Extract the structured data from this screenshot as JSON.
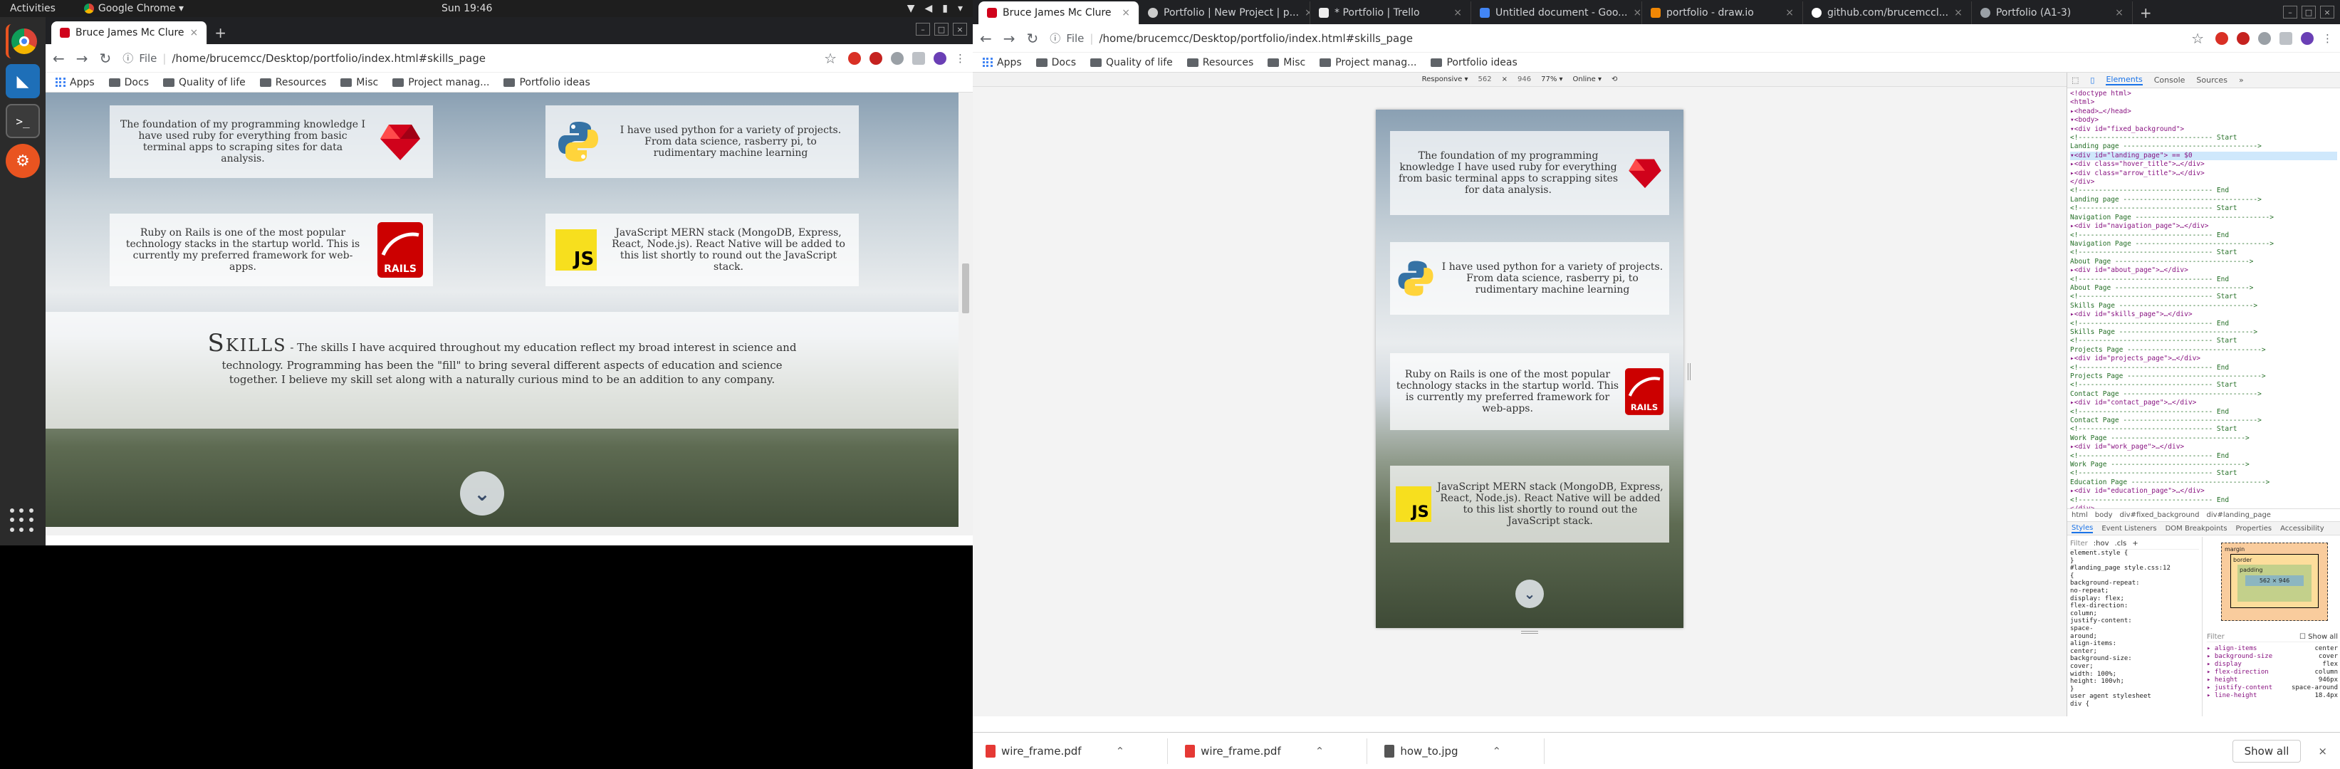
{
  "topbar": {
    "activities": "Activities",
    "app": "Google Chrome ▾",
    "clock": "Sun 19:46"
  },
  "dock": {
    "items": [
      "chrome-icon",
      "vscode-icon",
      "terminal-icon",
      "settings-icon"
    ]
  },
  "left": {
    "tab_title": "Bruce James Mc Clure",
    "url_scheme": "File",
    "url": "/home/brucemcc/Desktop/portfolio/index.html#skills_page",
    "bookmarks": [
      "Apps",
      "Docs",
      "Quality of life",
      "Resources",
      "Misc",
      "Project manag...",
      "Portfolio ideas"
    ],
    "cards": [
      {
        "text": "The foundation of my programming knowledge I have used ruby for everything from basic terminal apps to scraping sites for data analysis.",
        "logo": "ruby-logo"
      },
      {
        "text": "I have used python for a variety of projects. From data science, rasberry pi, to rudimentary machine learning",
        "logo": "python-logo"
      },
      {
        "text": "Ruby on Rails is one of the most popular technology stacks in the startup world. This is currently my preferred framework for web-apps.",
        "logo": "rails-logo"
      },
      {
        "text": "JavaScript MERN stack (MongoDB, Express, React, Node.js). React Native will be added to this list shortly to round out the JavaScript stack.",
        "logo": "js-logo"
      }
    ],
    "skills_heading": "Skills",
    "skills_text": " - The skills I have acquired throughout my education reflect my broad interest in science and technology. Programming has been the \"fill\" to bring several different aspects of education and science together. I believe my skill set along with a naturally curious mind to be an addition to any company."
  },
  "right": {
    "tabs": [
      "Bruce James Mc Clure",
      "Portfolio | New Project | p...",
      "* Portfolio | Trello",
      "Untitled document - Goo...",
      "portfolio - draw.io",
      "github.com/brucemccl...",
      "Portfolio (A1-3)"
    ],
    "url_scheme": "File",
    "url": "/home/brucemcc/Desktop/portfolio/index.html#skills_page",
    "bookmarks": [
      "Apps",
      "Docs",
      "Quality of life",
      "Resources",
      "Misc",
      "Project manag...",
      "Portfolio ideas"
    ],
    "device_bar": {
      "mode": "Responsive ▾",
      "width": "562",
      "x": "×",
      "height": "946",
      "zoom": "77% ▾",
      "network": "Online ▾"
    },
    "mobile_cards": [
      {
        "text": "The foundation of my programming knowledge I have used ruby for everything from basic terminal apps to scrapping sites for data analysis.",
        "logo": "ruby-logo"
      },
      {
        "text": "I have used python for a variety of projects. From data science, rasberry pi, to rudimentary machine learning",
        "logo": "python-logo"
      },
      {
        "text": "Ruby on Rails is one of the most popular technology stacks in the startup world. This is currently my preferred framework for web-apps.",
        "logo": "rails-logo"
      },
      {
        "text": "JavaScript MERN stack (MongoDB, Express, React, Node.js). React Native will be added to this list shortly to round out the JavaScript stack.",
        "logo": "js-logo"
      }
    ],
    "devtools": {
      "tabs": [
        "Elements",
        "Console",
        "Sources",
        "»"
      ],
      "dom": [
        "<!doctype html>",
        "<html>",
        " ▸<head>…</head>",
        " ▾<body>",
        "  ▾<div id=\"fixed_background\">",
        "    <!--------------------------------- Start",
        "    Landing page --------------------------------->",
        "   ▾<div id=\"landing_page\"> == $0",
        "     ▸<div class=\"hover_title\">…</div>",
        "     ▸<div class=\"arrow_title\">…</div>",
        "    </div>",
        "    <!--------------------------------- End",
        "    Landing page --------------------------------->",
        "    <!--------------------------------- Start",
        "    Navigation Page --------------------------------->",
        "   ▸<div id=\"navigation_page\">…</div>",
        "    <!--------------------------------- End",
        "    Navigation Page --------------------------------->",
        "    <!--------------------------------- Start",
        "    About Page --------------------------------->",
        "   ▸<div id=\"about_page\">…</div>",
        "    <!--------------------------------- End",
        "    About Page --------------------------------->",
        "    <!--------------------------------- Start",
        "    Skills Page --------------------------------->",
        "   ▸<div id=\"skills_page\">…</div>",
        "    <!--------------------------------- End",
        "    Skills Page --------------------------------->",
        "    <!--------------------------------- Start",
        "    Projects Page --------------------------------->",
        "   ▸<div id=\"projects_page\">…</div>",
        "    <!--------------------------------- End",
        "    Projects Page --------------------------------->",
        "    <!--------------------------------- Start",
        "    Contact Page --------------------------------->",
        "   ▸<div id=\"contact_page\">…</div>",
        "    <!--------------------------------- End",
        "    Contact Page --------------------------------->",
        "    <!--------------------------------- Start",
        "    Work Page --------------------------------->",
        "   ▸<div id=\"work_page\">…</div>",
        "    <!--------------------------------- End",
        "    Work Page --------------------------------->",
        "    <!--------------------------------- Start",
        "    Education Page --------------------------------->",
        "   ▸<div id=\"education_page\">…</div>",
        "    <!--------------------------------- End",
        "  </div>"
      ],
      "breadcrumb": [
        "html",
        "body",
        "div#fixed_background",
        "div#landing_page"
      ],
      "subtabs": [
        "Styles",
        "Event Listeners",
        "DOM Breakpoints",
        "Properties",
        "Accessibility"
      ],
      "filter": "Filter",
      "hov": ":hov",
      "cls": ".cls",
      "plus": "+",
      "styles": [
        "element.style {",
        "}",
        "#landing_page  style.css:12",
        "{",
        "  background-repeat:",
        "    no-repeat;",
        "  display: flex;",
        "  flex-direction:",
        "    column;",
        "  justify-content:",
        "    space-",
        "    around;",
        "  align-items:",
        "    center;",
        "  background-size:",
        "    cover;",
        "  width: 100%;",
        "  height: 100vh;",
        "}",
        "user agent stylesheet",
        "div {"
      ],
      "computed": [
        [
          "align-items",
          "center"
        ],
        [
          "background-size",
          "cover"
        ],
        [
          "display",
          "flex"
        ],
        [
          "flex-direction",
          "column"
        ],
        [
          "height",
          "946px"
        ],
        [
          "justify-content",
          "space-around"
        ],
        [
          "line-height",
          "18.4px"
        ]
      ],
      "computed_filter": "Filter",
      "show_all": "Show all",
      "boxmodel": {
        "margin": "margin",
        "border": "border",
        "padding": "padding",
        "content": "562 × 946"
      }
    },
    "downloads": [
      "wire_frame.pdf",
      "wire_frame.pdf",
      "how_to.jpg"
    ],
    "show_all": "Show all"
  },
  "colors": {
    "ruby": "#d0021b",
    "python_blue": "#3572a5",
    "python_yellow": "#ffd43b",
    "rails": "#cc0000",
    "js": "#f7df1e",
    "accent": "#1a73e8"
  }
}
